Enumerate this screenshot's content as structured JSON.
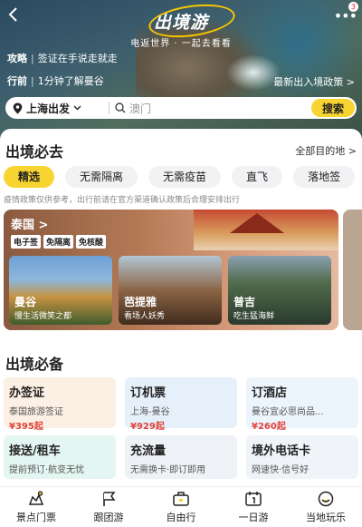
{
  "header": {
    "title": "出境游",
    "slogan": "电返世界 · 一起去看看",
    "more_badge": "3",
    "tips": [
      {
        "label": "攻略",
        "text": "签证在手说走就走"
      },
      {
        "label": "行前",
        "text": "1分钟了解曼谷"
      }
    ],
    "policy_link": "最新出入境政策 >"
  },
  "search": {
    "departure": "上海出发",
    "placeholder": "澳门",
    "button": "搜索"
  },
  "must_go": {
    "title": "出境必去",
    "all_link": "全部目的地 >",
    "chips": [
      "精选",
      "无需隔离",
      "无需疫苗",
      "直飞",
      "落地签"
    ],
    "notice": "疫情政策仅供参考，出行前请在官方渠道确认政策后合理安排出行",
    "card": {
      "country": "泰国 >",
      "badges": [
        "电子签",
        "免隔离",
        "免核酸"
      ],
      "cities": [
        {
          "name": "曼谷",
          "desc": "慢生活微笑之都"
        },
        {
          "name": "芭提雅",
          "desc": "看场人妖秀"
        },
        {
          "name": "普吉",
          "desc": "吃生猛海鲜"
        }
      ]
    }
  },
  "essentials": {
    "title": "出境必备",
    "items": [
      {
        "title": "办签证",
        "sub": "泰国旅游签证",
        "price": "¥395起"
      },
      {
        "title": "订机票",
        "sub": "上海-曼谷",
        "price": "¥929起"
      },
      {
        "title": "订酒店",
        "sub": "曼谷宜必思尚品...",
        "price": "¥260起"
      },
      {
        "title": "接送/租车",
        "sub": "提前预订·航变无忧",
        "price": ""
      },
      {
        "title": "充流量",
        "sub": "无需换卡·即订即用",
        "price": ""
      },
      {
        "title": "境外电话卡",
        "sub": "网速快·信号好",
        "price": ""
      }
    ]
  },
  "tabbar": [
    {
      "label": "景点门票",
      "icon": "ticket-icon"
    },
    {
      "label": "跟团游",
      "icon": "flag-icon"
    },
    {
      "label": "自由行",
      "icon": "suitcase-icon"
    },
    {
      "label": "一日游",
      "icon": "calendar-icon"
    },
    {
      "label": "当地玩乐",
      "icon": "smile-icon"
    }
  ],
  "colors": {
    "accent": "#f7d430",
    "price": "#e0443a"
  }
}
